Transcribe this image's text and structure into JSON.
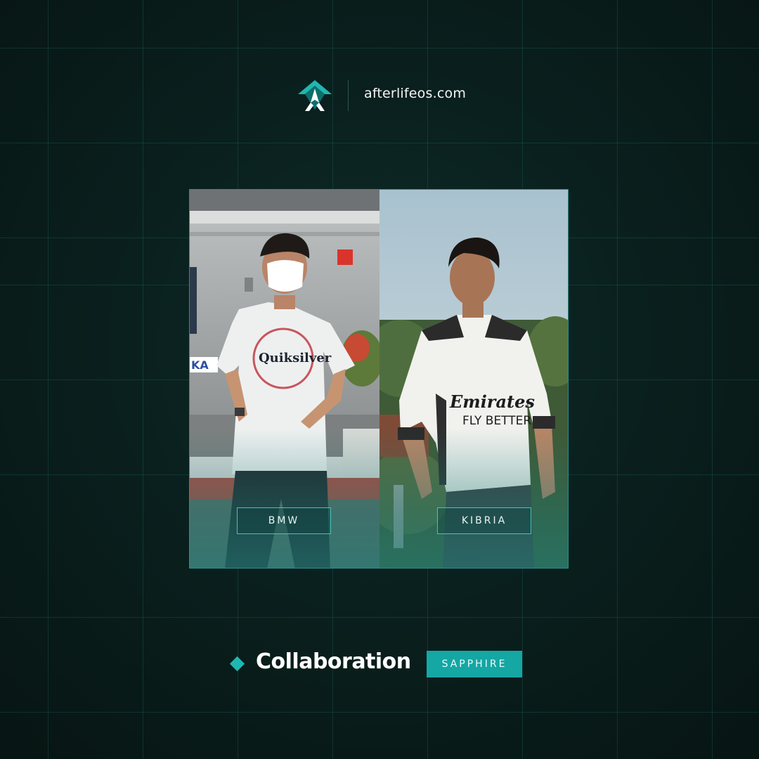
{
  "header": {
    "logo_icon": "afterlife-arrow-logo-icon",
    "site_url": "afterlifeos.com"
  },
  "photos": [
    {
      "name": "BMW"
    },
    {
      "name": "KIBRIA"
    }
  ],
  "footer": {
    "bullet_icon": "diamond-icon",
    "title": "Collaboration",
    "badge": "SAPPHIRE"
  },
  "colors": {
    "background": "#0a201e",
    "accent": "#14a7a4",
    "grid": "#1f5e58"
  }
}
